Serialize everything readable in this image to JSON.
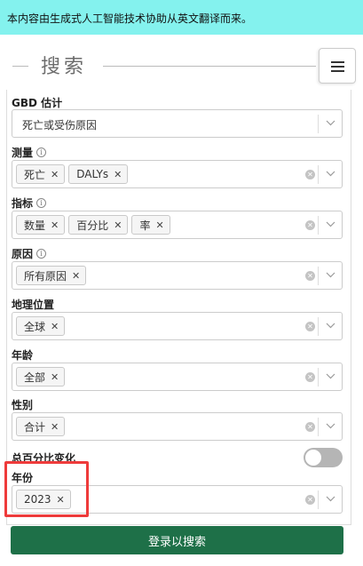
{
  "banner": {
    "text": "本内容由生成式人工智能技术协助从英文翻译而来。"
  },
  "header": {
    "title": "搜索"
  },
  "fields": {
    "estimate": {
      "label": "GBD 估计",
      "value": "死亡或受伤原因"
    },
    "measure": {
      "label": "测量",
      "chips": [
        "死亡",
        "DALYs"
      ]
    },
    "metric": {
      "label": "指标",
      "chips": [
        "数量",
        "百分比",
        "率"
      ]
    },
    "cause": {
      "label": "原因",
      "chips": [
        "所有原因"
      ]
    },
    "location": {
      "label": "地理位置",
      "chips": [
        "全球"
      ]
    },
    "age": {
      "label": "年龄",
      "chips": [
        "全部"
      ]
    },
    "sex": {
      "label": "性别",
      "chips": [
        "合计"
      ]
    },
    "total_percent_change": {
      "label": "总百分比变化",
      "enabled": false
    },
    "year": {
      "label": "年份",
      "chips": [
        "2023"
      ]
    }
  },
  "actions": {
    "login_label": "登录以搜索"
  },
  "colors": {
    "banner": "#84f2ee",
    "primary_button": "#1e7048",
    "highlight": "#ee3b3b"
  }
}
